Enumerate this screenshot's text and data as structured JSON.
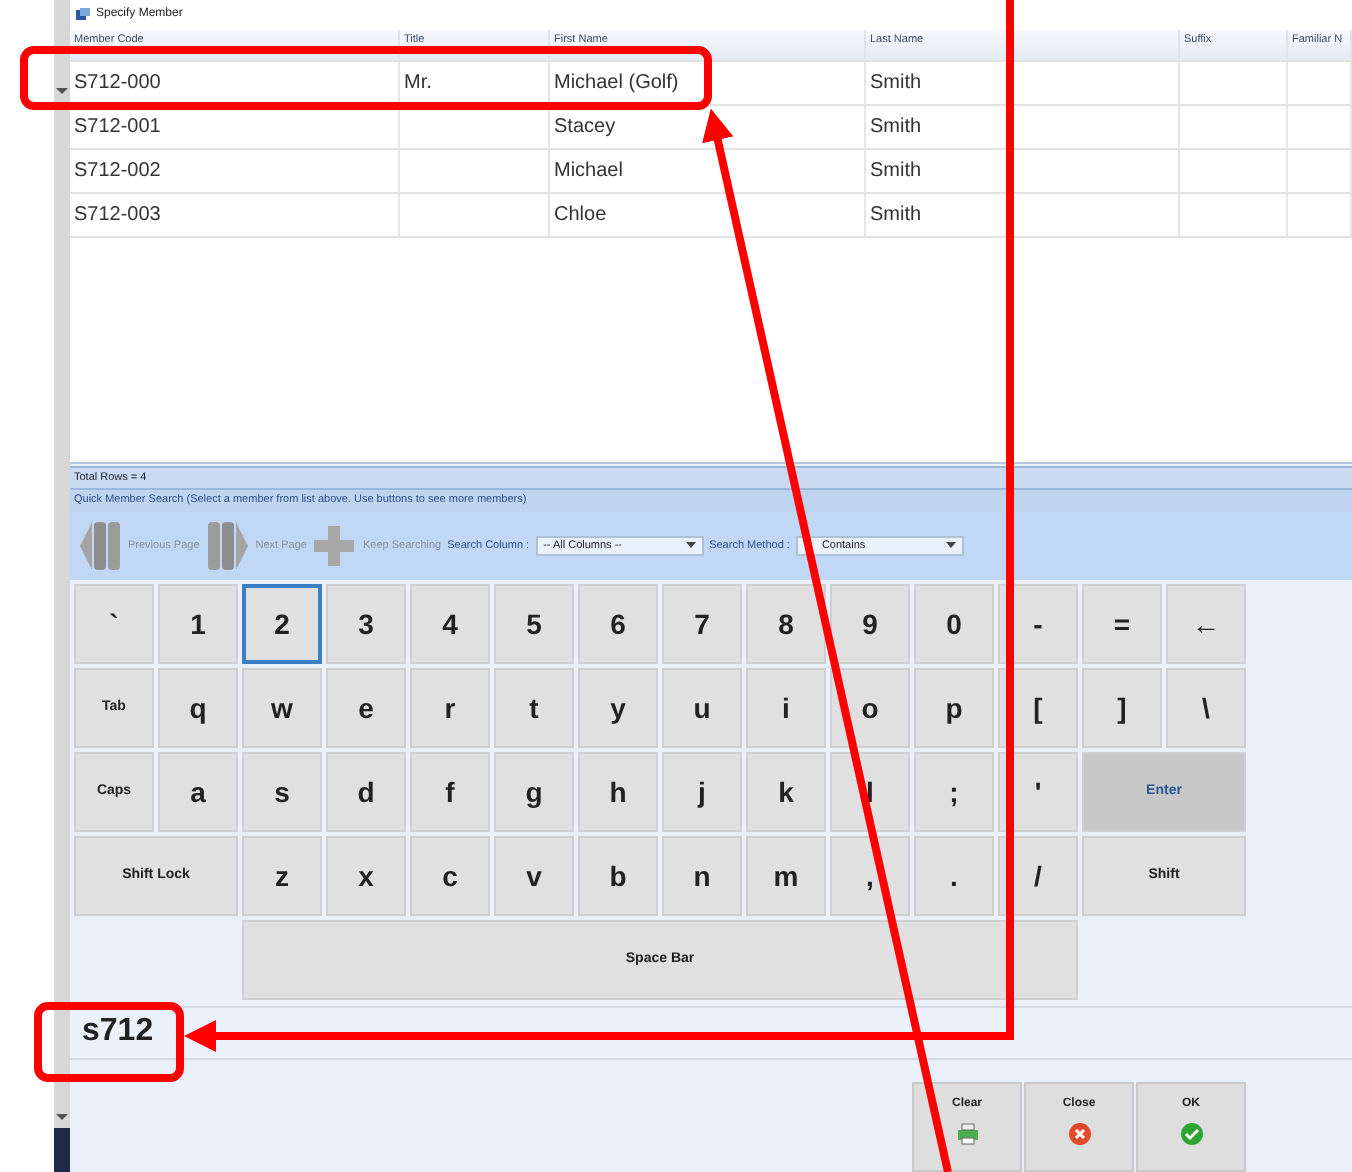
{
  "window": {
    "title": "Specify Member"
  },
  "table": {
    "columns": [
      "Member Code",
      "Title",
      "First Name",
      "Last Name",
      "Suffix",
      "Familiar N"
    ],
    "rows": [
      {
        "cells": [
          "S712-000",
          "Mr.",
          "Michael (Golf)",
          "Smith",
          "",
          ""
        ],
        "selected": false
      },
      {
        "cells": [
          "S712-001",
          "",
          "Stacey",
          "Smith",
          "",
          ""
        ],
        "selected": false
      },
      {
        "cells": [
          "S712-002",
          "",
          "Michael",
          "Smith",
          "",
          ""
        ],
        "selected": false
      },
      {
        "cells": [
          "S712-003",
          "",
          "Chloe",
          "Smith",
          "",
          ""
        ],
        "selected": false
      }
    ]
  },
  "total_rows": "Total Rows = 4",
  "quick_search": {
    "caption": "Quick Member Search (Select a member from list above. Use buttons to see more members)",
    "tools": [
      {
        "kind": "prev",
        "label": "Previous Page",
        "disabled": true
      },
      {
        "kind": "next",
        "label": "Next Page",
        "disabled": true
      },
      {
        "kind": "plus",
        "label": "Keep Searching",
        "disabled": true
      }
    ],
    "selects": [
      {
        "label": "Search Column :",
        "value": "-- All Columns --"
      },
      {
        "label": "Search Method :",
        "value": "Contains"
      }
    ]
  },
  "keyboard": [
    [
      {
        "label": "`",
        "kind": "char",
        "selected": false
      },
      {
        "label": "1",
        "kind": "char",
        "selected": false
      },
      {
        "label": "2",
        "kind": "char",
        "selected": true
      },
      {
        "label": "3",
        "kind": "char",
        "selected": false
      },
      {
        "label": "4",
        "kind": "char",
        "selected": false
      },
      {
        "label": "5",
        "kind": "char",
        "selected": false
      },
      {
        "label": "6",
        "kind": "char",
        "selected": false
      },
      {
        "label": "7",
        "kind": "char",
        "selected": false
      },
      {
        "label": "8",
        "kind": "char",
        "selected": false
      },
      {
        "label": "9",
        "kind": "char",
        "selected": false
      },
      {
        "label": "0",
        "kind": "char",
        "selected": false
      },
      {
        "label": "-",
        "kind": "char",
        "selected": false
      },
      {
        "label": "=",
        "kind": "char",
        "selected": false
      },
      {
        "label": "←",
        "kind": "char",
        "selected": false
      }
    ],
    [
      {
        "label": "Tab",
        "kind": "small",
        "selected": false
      },
      {
        "label": "q",
        "kind": "char",
        "selected": false
      },
      {
        "label": "w",
        "kind": "char",
        "selected": false
      },
      {
        "label": "e",
        "kind": "char",
        "selected": false
      },
      {
        "label": "r",
        "kind": "char",
        "selected": false
      },
      {
        "label": "t",
        "kind": "char",
        "selected": false
      },
      {
        "label": "y",
        "kind": "char",
        "selected": false
      },
      {
        "label": "u",
        "kind": "char",
        "selected": false
      },
      {
        "label": "i",
        "kind": "char",
        "selected": false
      },
      {
        "label": "o",
        "kind": "char",
        "selected": false
      },
      {
        "label": "p",
        "kind": "char",
        "selected": false
      },
      {
        "label": "[",
        "kind": "char",
        "selected": false
      },
      {
        "label": "]",
        "kind": "char",
        "selected": false
      },
      {
        "label": "\\",
        "kind": "char",
        "selected": false
      }
    ],
    [
      {
        "label": "Caps",
        "kind": "small",
        "selected": false
      },
      {
        "label": "a",
        "kind": "char",
        "selected": false
      },
      {
        "label": "s",
        "kind": "char",
        "selected": false
      },
      {
        "label": "d",
        "kind": "char",
        "selected": false
      },
      {
        "label": "f",
        "kind": "char",
        "selected": false
      },
      {
        "label": "g",
        "kind": "char",
        "selected": false
      },
      {
        "label": "h",
        "kind": "char",
        "selected": false
      },
      {
        "label": "j",
        "kind": "char",
        "selected": false
      },
      {
        "label": "k",
        "kind": "char",
        "selected": false
      },
      {
        "label": "l",
        "kind": "char",
        "selected": false
      },
      {
        "label": ";",
        "kind": "char",
        "selected": false
      },
      {
        "label": "'",
        "kind": "char",
        "selected": false
      },
      {
        "label": "Enter",
        "kind": "enter",
        "selected": false
      }
    ],
    [
      {
        "label": "Shift Lock",
        "kind": "wide",
        "selected": false
      },
      {
        "label": "z",
        "kind": "char",
        "selected": false
      },
      {
        "label": "x",
        "kind": "char",
        "selected": false
      },
      {
        "label": "c",
        "kind": "char",
        "selected": false
      },
      {
        "label": "v",
        "kind": "char",
        "selected": false
      },
      {
        "label": "b",
        "kind": "char",
        "selected": false
      },
      {
        "label": "n",
        "kind": "char",
        "selected": false
      },
      {
        "label": "m",
        "kind": "char",
        "selected": false
      },
      {
        "label": ",",
        "kind": "char",
        "selected": false
      },
      {
        "label": ".",
        "kind": "char",
        "selected": false
      },
      {
        "label": "/",
        "kind": "char",
        "selected": false
      },
      {
        "label": "Shift",
        "kind": "wide",
        "selected": false
      }
    ],
    [
      {
        "label": "Space Bar",
        "kind": "space",
        "selected": false
      }
    ]
  ],
  "input": {
    "value": "s712"
  },
  "buttons": [
    {
      "kind": "clear",
      "label": "Clear"
    },
    {
      "kind": "close",
      "label": "Close"
    },
    {
      "kind": "ok",
      "label": "OK"
    }
  ]
}
